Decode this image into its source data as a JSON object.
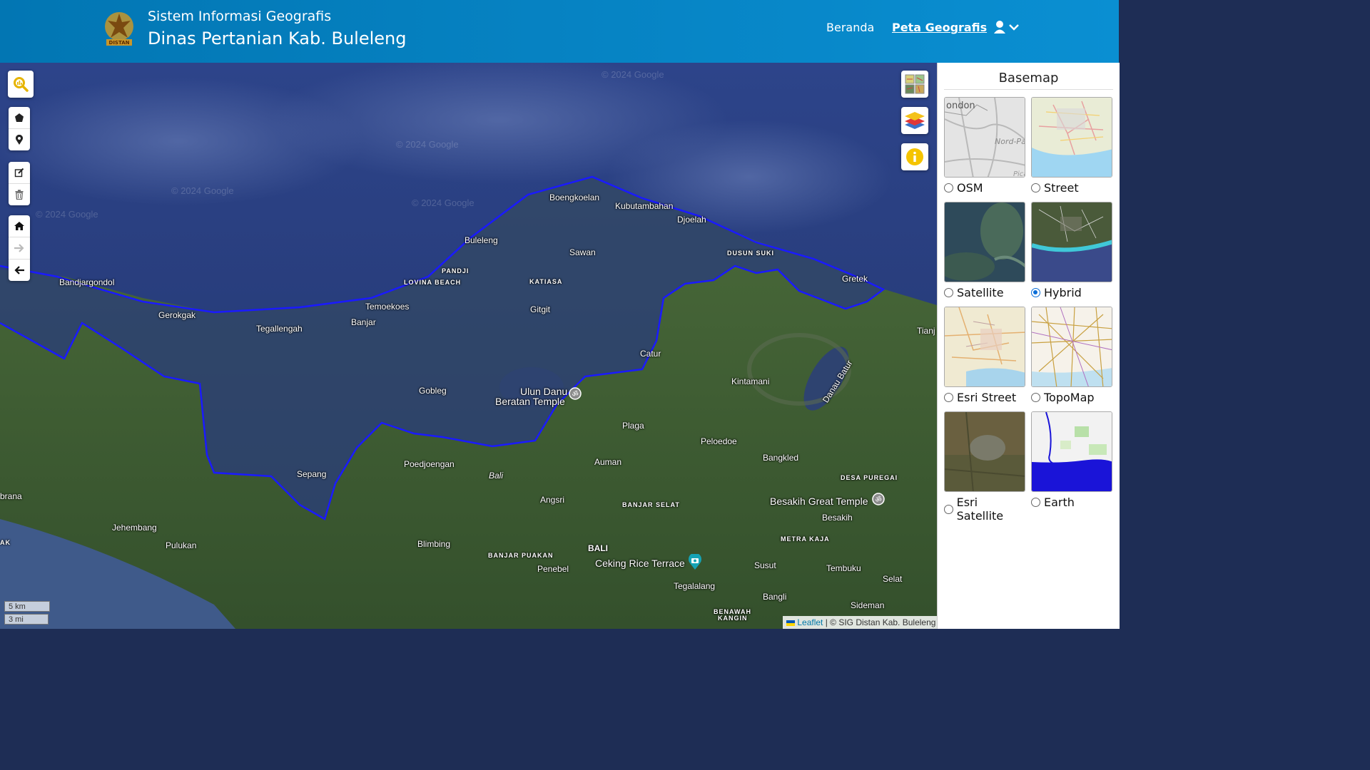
{
  "header": {
    "title_line1": "Sistem Informasi Geografis",
    "title_line2": "Dinas Pertanian Kab. Buleleng",
    "logo_text": "DISTAN",
    "nav": [
      {
        "label": "Beranda",
        "active": false
      },
      {
        "label": "Peta Geografis",
        "active": true
      }
    ]
  },
  "map": {
    "watermark": "© 2024 Google",
    "places": [
      {
        "name": "Boengkoelan",
        "style": "normal"
      },
      {
        "name": "Kubutambahan",
        "style": "normal"
      },
      {
        "name": "Djoelah",
        "style": "normal"
      },
      {
        "name": "Buleleng",
        "style": "normal"
      },
      {
        "name": "Sawan",
        "style": "normal"
      },
      {
        "name": "DUSUN SUKI",
        "style": "caps"
      },
      {
        "name": "PANDJI",
        "style": "caps"
      },
      {
        "name": "LOVINA BEACH",
        "style": "caps"
      },
      {
        "name": "KATIASA",
        "style": "caps"
      },
      {
        "name": "Gretek",
        "style": "normal"
      },
      {
        "name": "Bandjargondol",
        "style": "normal"
      },
      {
        "name": "Temoekoes",
        "style": "normal"
      },
      {
        "name": "Gerokgak",
        "style": "normal"
      },
      {
        "name": "Gitgit",
        "style": "normal"
      },
      {
        "name": "Tegallengah",
        "style": "normal"
      },
      {
        "name": "Banjar",
        "style": "normal"
      },
      {
        "name": "Tianj",
        "style": "normal"
      },
      {
        "name": "Catur",
        "style": "normal"
      },
      {
        "name": "Kintamani",
        "style": "normal"
      },
      {
        "name": "Danau Batur",
        "style": "normal"
      },
      {
        "name": "Gobleg",
        "style": "normal"
      },
      {
        "name": "Ulun Danu",
        "style": "big"
      },
      {
        "name": "Beratan Temple",
        "style": "big"
      },
      {
        "name": "Plaga",
        "style": "normal"
      },
      {
        "name": "Peloedoe",
        "style": "normal"
      },
      {
        "name": "Sepang",
        "style": "normal"
      },
      {
        "name": "Poedjoengan",
        "style": "normal"
      },
      {
        "name": "Auman",
        "style": "normal"
      },
      {
        "name": "Bangkled",
        "style": "normal"
      },
      {
        "name": "Bali",
        "style": "normal"
      },
      {
        "name": "DESA PUREGAI",
        "style": "caps"
      },
      {
        "name": "brana",
        "style": "normal"
      },
      {
        "name": "Angsri",
        "style": "normal"
      },
      {
        "name": "BANJAR SELAT",
        "style": "caps"
      },
      {
        "name": "Besakih Great Temple",
        "style": "big"
      },
      {
        "name": "Besakih",
        "style": "normal"
      },
      {
        "name": "Jehembang",
        "style": "normal"
      },
      {
        "name": "METRA KAJA",
        "style": "caps"
      },
      {
        "name": "AK",
        "style": "caps"
      },
      {
        "name": "Pulukan",
        "style": "normal"
      },
      {
        "name": "Blimbing",
        "style": "normal"
      },
      {
        "name": "BALI",
        "style": "normal"
      },
      {
        "name": "BANJAR PUAKAN",
        "style": "caps"
      },
      {
        "name": "Ceking Rice Terrace",
        "style": "big"
      },
      {
        "name": "Penebel",
        "style": "normal"
      },
      {
        "name": "Susut",
        "style": "normal"
      },
      {
        "name": "Tembuku",
        "style": "normal"
      },
      {
        "name": "Selat",
        "style": "normal"
      },
      {
        "name": "Tegalalang",
        "style": "normal"
      },
      {
        "name": "Bangli",
        "style": "normal"
      },
      {
        "name": "Sideman",
        "style": "normal"
      },
      {
        "name": "BENAWAH",
        "style": "caps"
      },
      {
        "name": "KANGIN",
        "style": "caps"
      }
    ],
    "scale_km": "5 km",
    "scale_mi": "3 mi",
    "attribution_link": "Leaflet",
    "attribution_text": "| © SIG Distan Kab. Buleleng",
    "colors": {
      "boundary": "#1a1aff",
      "sea": "#2b3f7a",
      "land": "#3e5e34"
    }
  },
  "panel": {
    "title": "Basemap",
    "options": [
      {
        "label": "OSM",
        "selected": false
      },
      {
        "label": "Street",
        "selected": false
      },
      {
        "label": "Satellite",
        "selected": false
      },
      {
        "label": "Hybrid",
        "selected": true
      },
      {
        "label": "Esri Street",
        "selected": false
      },
      {
        "label": "TopoMap",
        "selected": false
      },
      {
        "label": "Esri Satellite",
        "selected": false
      },
      {
        "label": "Earth",
        "selected": false
      }
    ],
    "thumb_texts": {
      "osm_a": "ondon",
      "osm_b": "Nord-Pas-d",
      "osm_c": "Pica"
    }
  }
}
